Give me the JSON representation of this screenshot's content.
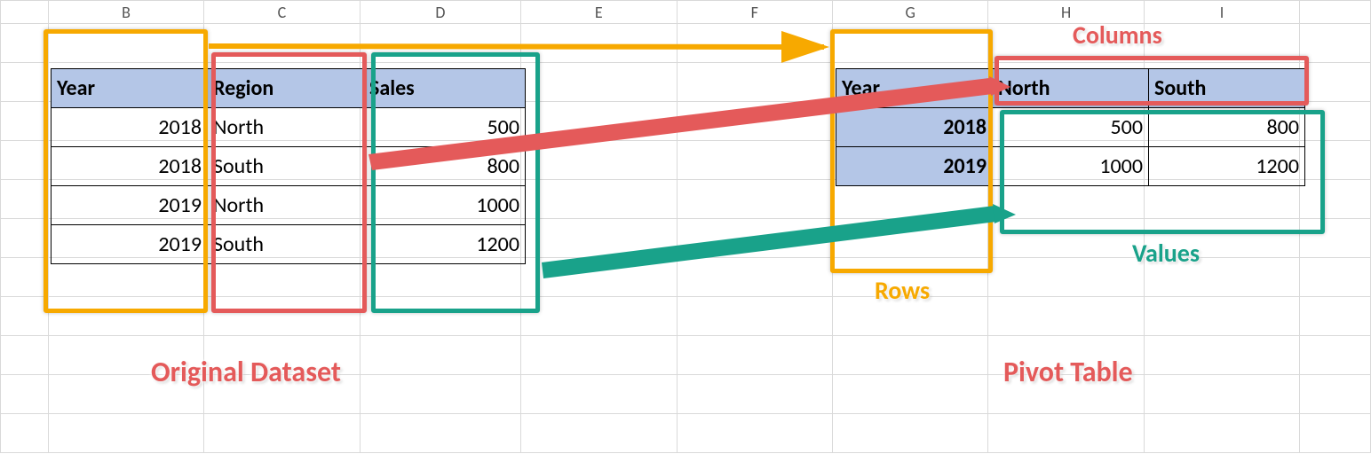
{
  "columns": [
    "B",
    "C",
    "D",
    "E",
    "F",
    "G",
    "H",
    "I"
  ],
  "source": {
    "headers": {
      "year": "Year",
      "region": "Region",
      "sales": "Sales"
    },
    "rows": [
      {
        "year": "2018",
        "region": "North",
        "sales": "500"
      },
      {
        "year": "2018",
        "region": "South",
        "sales": "800"
      },
      {
        "year": "2019",
        "region": "North",
        "sales": "1000"
      },
      {
        "year": "2019",
        "region": "South",
        "sales": "1200"
      }
    ]
  },
  "pivot": {
    "rowlabel": "Year",
    "colheaders": [
      "North",
      "South"
    ],
    "rows": [
      {
        "year": "2018",
        "vals": [
          "500",
          "800"
        ]
      },
      {
        "year": "2019",
        "vals": [
          "1000",
          "1200"
        ]
      }
    ]
  },
  "labels": {
    "orig": "Original Dataset",
    "pivot": "Pivot Table",
    "rows": "Rows",
    "columns": "Columns",
    "values": "Values"
  }
}
